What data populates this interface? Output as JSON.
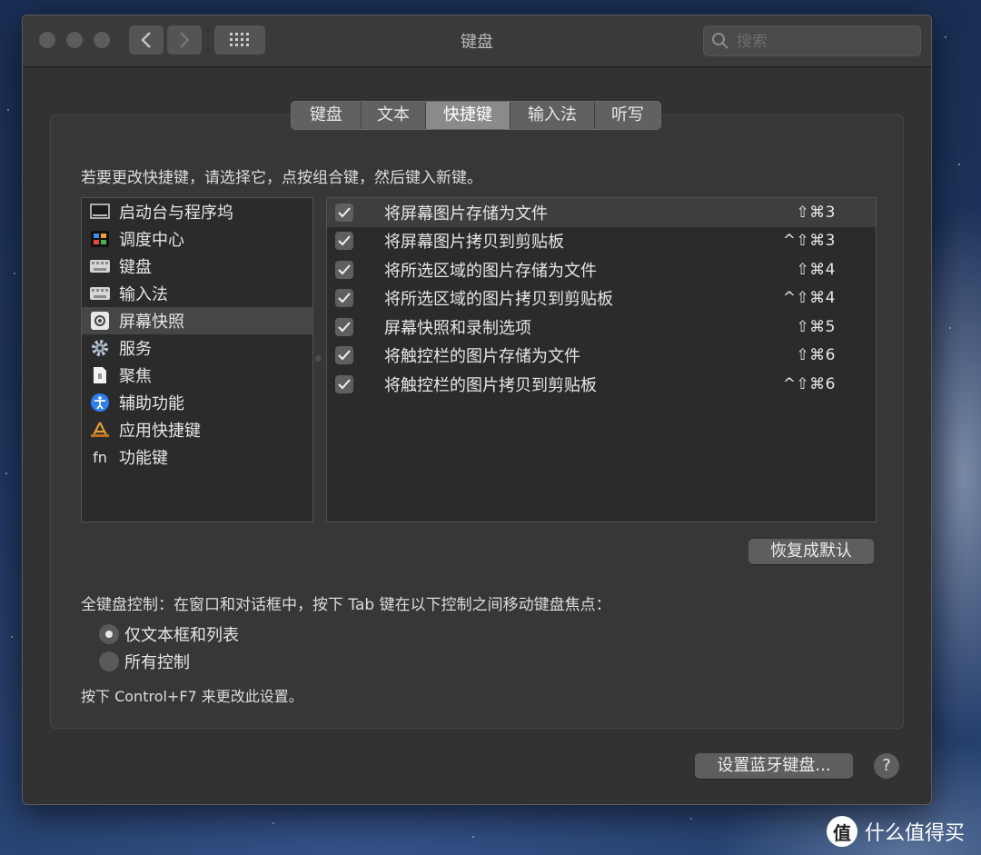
{
  "window": {
    "title": "键盘"
  },
  "search": {
    "placeholder": "搜索"
  },
  "tabs": [
    {
      "label": "键盘"
    },
    {
      "label": "文本"
    },
    {
      "label": "快捷键",
      "active": true
    },
    {
      "label": "输入法"
    },
    {
      "label": "听写"
    }
  ],
  "instruction": "若要更改快捷键，请选择它，点按组合键，然后键入新键。",
  "categories": [
    {
      "label": "启动台与程序坞",
      "icon": "dock-icon"
    },
    {
      "label": "调度中心",
      "icon": "mission-control-icon"
    },
    {
      "label": "键盘",
      "icon": "keyboard-icon"
    },
    {
      "label": "输入法",
      "icon": "keyboard-icon"
    },
    {
      "label": "屏幕快照",
      "icon": "screenshot-icon",
      "selected": true
    },
    {
      "label": "服务",
      "icon": "gear-icon"
    },
    {
      "label": "聚焦",
      "icon": "spotlight-doc-icon"
    },
    {
      "label": "辅助功能",
      "icon": "accessibility-icon"
    },
    {
      "label": "应用快捷键",
      "icon": "app-shortcuts-icon"
    },
    {
      "label": "功能键",
      "icon": "fn-icon",
      "icon_text": "fn"
    }
  ],
  "shortcuts": [
    {
      "label": "将屏幕图片存储为文件",
      "key": "⇧⌘3",
      "checked": true,
      "selected": true
    },
    {
      "label": "将屏幕图片拷贝到剪贴板",
      "key": "^⇧⌘3",
      "checked": true
    },
    {
      "label": "将所选区域的图片存储为文件",
      "key": "⇧⌘4",
      "checked": true
    },
    {
      "label": "将所选区域的图片拷贝到剪贴板",
      "key": "^⇧⌘4",
      "checked": true
    },
    {
      "label": "屏幕快照和录制选项",
      "key": "⇧⌘5",
      "checked": true
    },
    {
      "label": "将触控栏的图片存储为文件",
      "key": "⇧⌘6",
      "checked": true
    },
    {
      "label": "将触控栏的图片拷贝到剪贴板",
      "key": "^⇧⌘6",
      "checked": true
    }
  ],
  "buttons": {
    "restore_defaults": "恢复成默认",
    "bluetooth_keyboard": "设置蓝牙键盘...",
    "help": "?"
  },
  "keyboard_control": {
    "label": "全键盘控制：在窗口和对话框中，按下 Tab 键在以下控制之间移动键盘焦点：",
    "options": [
      {
        "label": "仅文本框和列表",
        "selected": true
      },
      {
        "label": "所有控制",
        "selected": false
      }
    ],
    "hint": "按下 Control+F7 来更改此设置。"
  },
  "watermark": {
    "badge": "值",
    "text": "什么值得买"
  },
  "colors": {
    "window_bg": "#323232",
    "list_bg": "#2b2b2b",
    "selection": "#464646",
    "button": "#5e5e5e"
  }
}
